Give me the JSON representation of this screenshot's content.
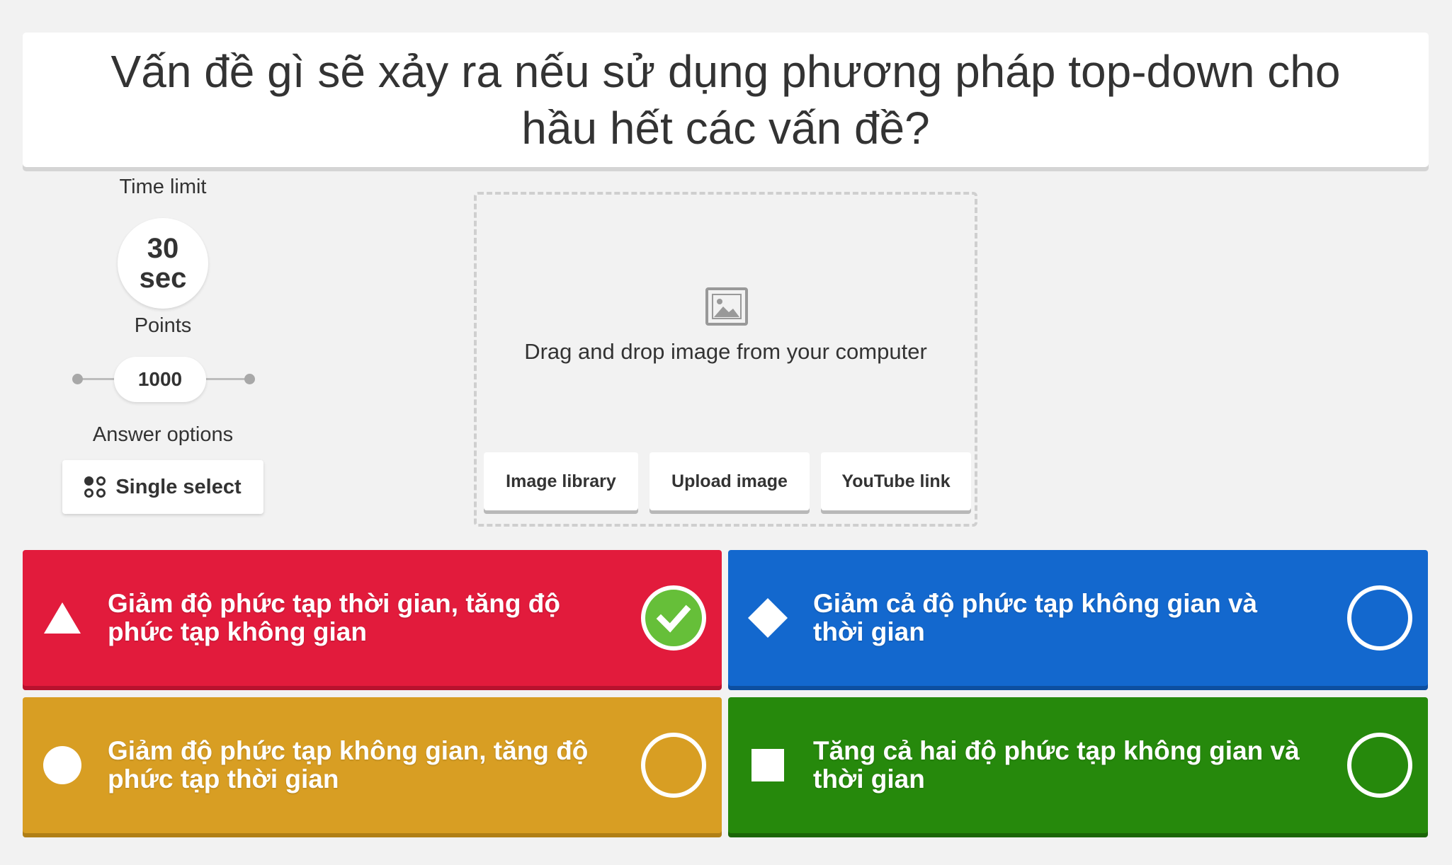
{
  "question": {
    "text": "Vấn đề gì sẽ xảy ra nếu sử dụng phương pháp top-down cho hầu hết các vấn đề?"
  },
  "settings": {
    "time_limit_label": "Time limit",
    "time_value": "30",
    "time_unit": "sec",
    "points_label": "Points",
    "points_value": "1000",
    "answer_options_label": "Answer options",
    "answer_options_value": "Single select"
  },
  "media": {
    "drop_text": "Drag and drop image from your computer",
    "buttons": [
      "Image library",
      "Upload image",
      "YouTube link"
    ]
  },
  "answers": [
    {
      "shape": "triangle",
      "text": "Giảm độ phức tạp thời gian, tăng độ phức tạp không gian",
      "correct": true,
      "color": "#e21b3c"
    },
    {
      "shape": "diamond",
      "text": "Giảm cả độ phức tạp không gian và thời gian",
      "correct": false,
      "color": "#1368ce"
    },
    {
      "shape": "circle",
      "text": "Giảm độ phức tạp không gian, tăng độ phức tạp thời gian",
      "correct": false,
      "color": "#d89e23"
    },
    {
      "shape": "square",
      "text": "Tăng cả hai độ phức tạp không gian và thời gian",
      "correct": false,
      "color": "#26890c"
    }
  ],
  "colors": {
    "background": "#f2f2f2",
    "correct_check": "#66bf39"
  }
}
